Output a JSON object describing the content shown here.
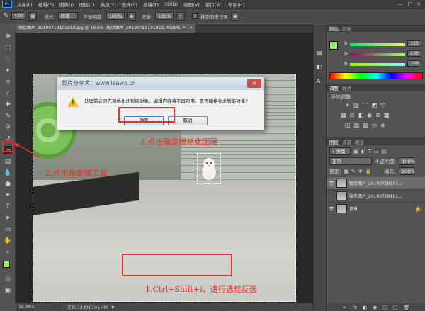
{
  "menubar": {
    "logo": "Ps",
    "items": [
      "文件(F)",
      "编辑(E)",
      "图像(I)",
      "图层(L)",
      "类型(Y)",
      "选择(S)",
      "滤镜(T)",
      "3D(D)",
      "视图(V)",
      "窗口(W)",
      "帮助(H)"
    ],
    "minimize": "—",
    "maximize": "□",
    "close": "✕"
  },
  "options": {
    "brush_size": "4297",
    "mode_label": "模式:",
    "mode_value": "画笔",
    "opacity_label": "不透明度:",
    "opacity_value": "100%",
    "flow_label": "流量:",
    "flow_value": "100%",
    "history_label": "抹到历史记录"
  },
  "document_tab": {
    "title": "微信图片_20190719101818.jpg @ 16.5% (微信图片_20190719101823, RGB/8) *",
    "close": "×"
  },
  "dialog": {
    "title": "照片分享术：www.leawo.cn",
    "close": "×",
    "message": "处理前必须先栅格化此智能对象。编辑内容将不再可用。是否栅格化此智能对象?",
    "ok": "确定",
    "cancel": "取消"
  },
  "annotations": {
    "step1": "1.Ctrl+Shift+i，进行选框反选",
    "step2": "2.点击橡皮擦工具",
    "step3": "3.点击确定栅格化图层"
  },
  "status": {
    "zoom": "16.46%",
    "doc": "文档:33.8M/101.4M"
  },
  "color_panel": {
    "tabs": [
      "颜色",
      "色板"
    ],
    "r_label": "R",
    "g_label": "G",
    "b_label": "B",
    "r": "153",
    "g": "235",
    "b": "109",
    "fg_color": "#99eb6d"
  },
  "adjust_panel": {
    "tabs": [
      "调整",
      "样式"
    ],
    "title": "添加调整"
  },
  "layers_panel": {
    "tabs": [
      "图层",
      "通道",
      "路径"
    ],
    "kind_label": "类型",
    "blend_mode": "正常",
    "opacity_label": "不透明度:",
    "opacity_value": "100%",
    "lock_label": "锁定:",
    "fill_label": "填充:",
    "fill_value": "100%",
    "layers": [
      {
        "name": "微信图片_20190719101...",
        "visible": true,
        "selected": true
      },
      {
        "name": "微信图片_20190719101...",
        "visible": false,
        "selected": false
      },
      {
        "name": "背景",
        "visible": true,
        "selected": false,
        "locked": true
      }
    ],
    "footer_icons": [
      "∞",
      "fx",
      "◐",
      "◉",
      "□",
      "▢",
      "🗑"
    ]
  }
}
